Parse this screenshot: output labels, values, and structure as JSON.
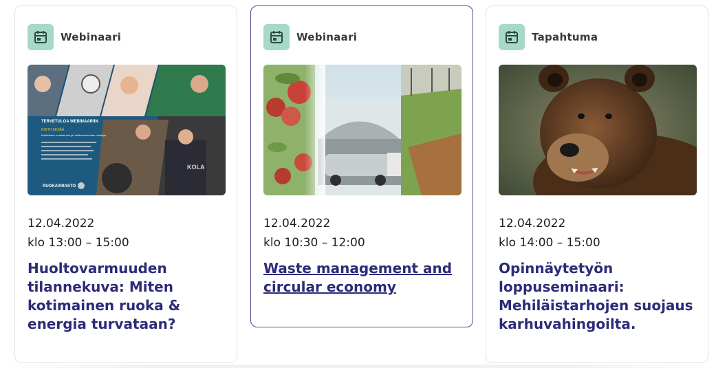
{
  "cards": [
    {
      "type": "Webinaari",
      "icon": "calendar-icon",
      "image": {
        "banner_title": "TERVETULOA WEBINAARIIN",
        "lines": [
          "KOHTI KESÄÄ",
          "Kotimaisen ruokaturvan ja huoltovarmuuden merkitys"
        ],
        "org": "RUOKAVIRASTO",
        "sign": "KOLA"
      },
      "date": "12.04.2022",
      "time": "klo 13:00 – 15:00",
      "title": "Huoltovarmuuden tilannekuva: Miten kotimainen ruoka & energia turvataan?"
    },
    {
      "type": "Webinaari",
      "icon": "calendar-icon",
      "date": "12.04.2022",
      "time": "klo 10:30 – 12:00",
      "title": "Waste management and circular economy"
    },
    {
      "type": "Tapahtuma",
      "icon": "calendar-icon",
      "date": "12.04.2022",
      "time": "klo 14:00 – 15:00",
      "title": "Opinnäytetyön loppuseminaari: Mehiläistarhojen suojaus karhuvahingoilta."
    }
  ],
  "colors": {
    "accent_icon_bg": "#a7d9c8",
    "title": "#2d2b79",
    "active_border": "#4b4b8f"
  }
}
